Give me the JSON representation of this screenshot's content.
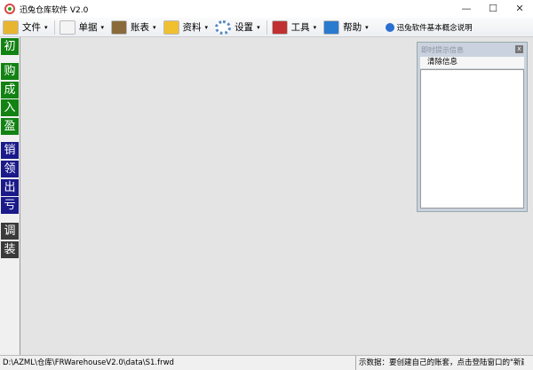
{
  "window": {
    "title": "迅兔仓库软件 V2.0",
    "minimize": "—",
    "maximize": "☐",
    "close": "✕"
  },
  "toolbar": {
    "items": [
      {
        "label": "文件",
        "icon": "folder-icon",
        "color": "#e8b530"
      },
      {
        "label": "单据",
        "icon": "document-icon",
        "color": "#f4f4f4"
      },
      {
        "label": "账表",
        "icon": "ledger-book-icon",
        "color": "#8a6a3a"
      },
      {
        "label": "资料",
        "icon": "binder-icon",
        "color": "#f0c030"
      },
      {
        "label": "设置",
        "icon": "gear-icon",
        "color": "#5a8ac0"
      },
      {
        "label": "工具",
        "icon": "tools-icon",
        "color": "#c03030"
      },
      {
        "label": "帮助",
        "icon": "info-icon",
        "color": "#2a7ad0"
      }
    ],
    "arrow": "▾",
    "link": "迅兔软件基本概念说明"
  },
  "sidebar": {
    "groups": [
      {
        "color": "#128212",
        "items": [
          "初"
        ]
      },
      {
        "color": "#128212",
        "items": [
          "购",
          "成",
          "入",
          "盈"
        ]
      },
      {
        "color": "#1a1a8a",
        "items": [
          "销",
          "领",
          "出",
          "亏"
        ]
      },
      {
        "color": "#3a3a3a",
        "items": [
          "调",
          "装"
        ]
      }
    ]
  },
  "panel": {
    "title": "即时提示信息",
    "close": "x",
    "clear_button": "清除信息"
  },
  "status": {
    "path": "D:\\AZML\\仓库\\FRWarehouseV2.0\\data\\S1.frwd",
    "hint": "示数据：要创建自己的账套，点击登陆窗口的\"新建\"按钮"
  }
}
